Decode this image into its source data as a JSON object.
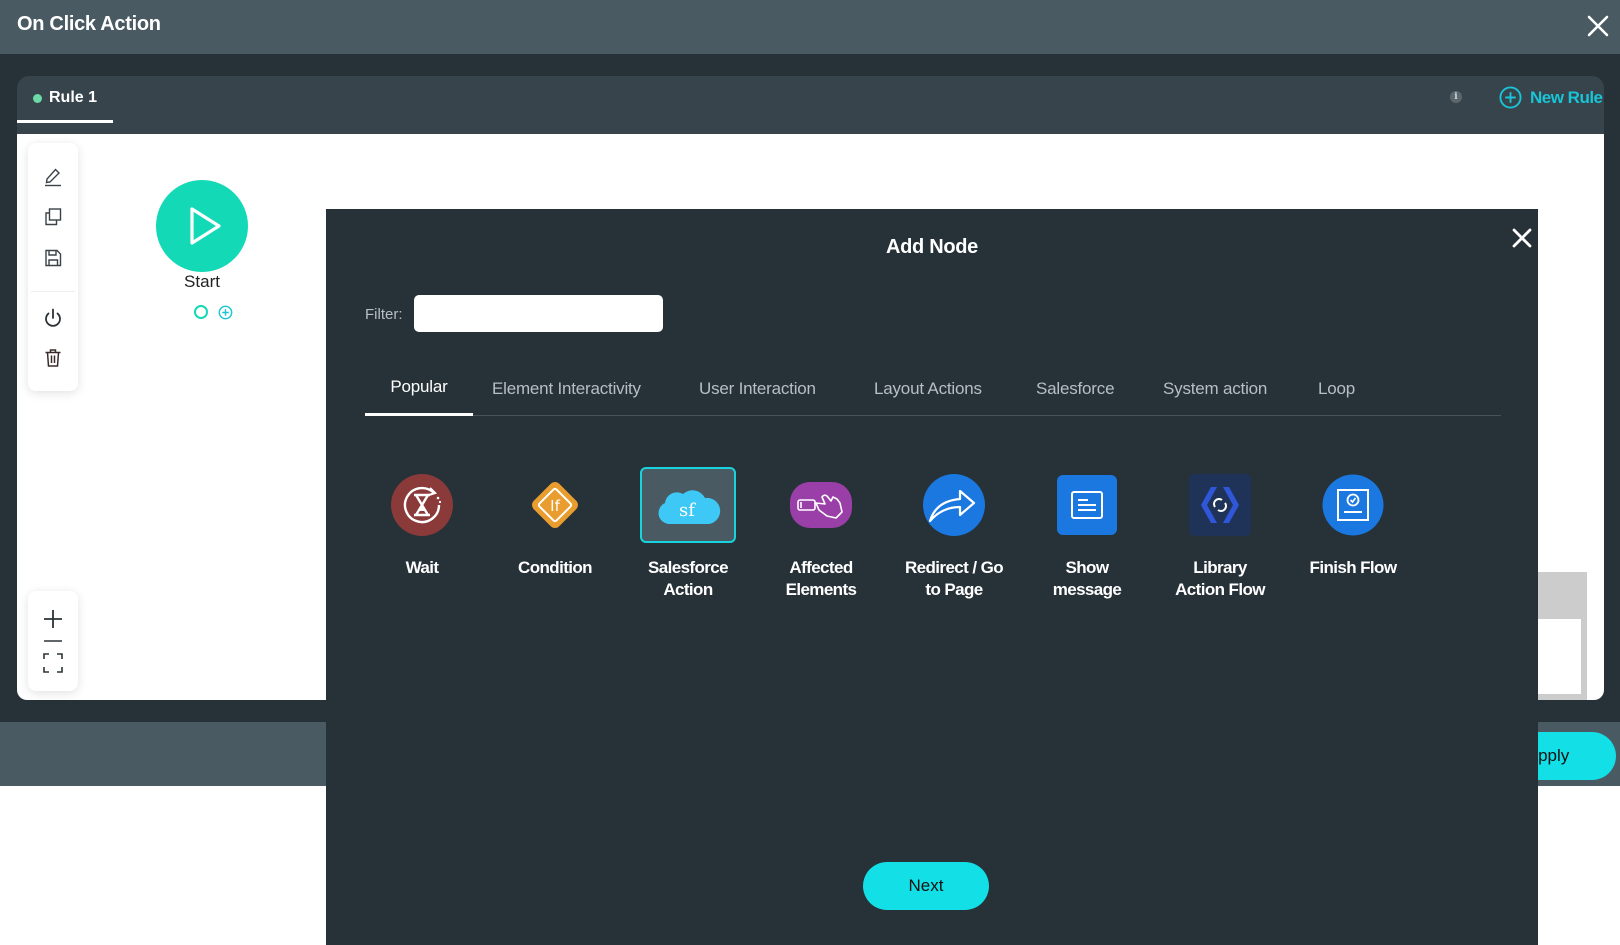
{
  "header": {
    "title": "On Click Action",
    "close_icon": "close-icon"
  },
  "rules": {
    "tabs": [
      {
        "label": "Rule 1",
        "active": true,
        "status_color": "#6ed9a8"
      }
    ],
    "info_glyph": "i",
    "new_rule_label": "New Rule"
  },
  "canvas": {
    "toolbar": [
      "edit-icon",
      "copy-icon",
      "save-icon",
      "power-icon",
      "trash-icon"
    ],
    "zoom_controls": [
      "zoom-in-icon",
      "zoom-out-icon",
      "fit-screen-icon"
    ],
    "start_node": {
      "label": "Start",
      "color": "#14d9b6"
    }
  },
  "footer": {
    "apply_label": "Apply"
  },
  "modal": {
    "title": "Add Node",
    "filter": {
      "label": "Filter:",
      "value": "",
      "placeholder": ""
    },
    "tabs": [
      {
        "label": "Popular",
        "active": true
      },
      {
        "label": "Element Interactivity",
        "active": false
      },
      {
        "label": "User Interaction",
        "active": false
      },
      {
        "label": "Layout Actions",
        "active": false
      },
      {
        "label": "Salesforce",
        "active": false
      },
      {
        "label": "System action",
        "active": false
      },
      {
        "label": "Loop",
        "active": false
      }
    ],
    "nodes": [
      {
        "label": "Wait",
        "icon": "hourglass-icon",
        "color": "#8b3a3a",
        "selected": false
      },
      {
        "label": "Condition",
        "icon": "if-diamond-icon",
        "color": "#e99d2e",
        "selected": false
      },
      {
        "label": "Salesforce\nAction",
        "icon": "salesforce-cloud-icon",
        "color": "#3ec8f5",
        "selected": true
      },
      {
        "label": "Affected\nElements",
        "icon": "hand-pointer-icon",
        "color": "#9b3fa8",
        "selected": false
      },
      {
        "label": "Redirect / Go\nto Page",
        "icon": "share-arrow-icon",
        "color": "#1a78e0",
        "selected": false
      },
      {
        "label": "Show\nmessage",
        "icon": "message-icon",
        "color": "#1a78e0",
        "selected": false
      },
      {
        "label": "Library\nAction Flow",
        "icon": "library-flow-icon",
        "color": "#1f3358",
        "selected": false
      },
      {
        "label": "Finish Flow",
        "icon": "finish-flow-icon",
        "color": "#1a78e0",
        "selected": false
      }
    ],
    "next_label": "Next",
    "accent_color": "#12e0e6"
  }
}
